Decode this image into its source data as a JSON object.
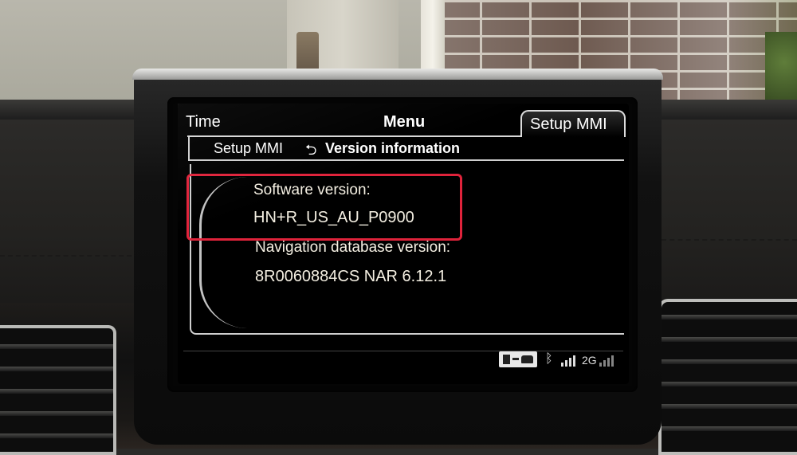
{
  "top_bar": {
    "left_tab": "Time",
    "center_tab": "Menu",
    "active_tab": "Setup MMI"
  },
  "breadcrumb": {
    "parent": "Setup MMI",
    "back_glyph": "⮌",
    "current": "Version information"
  },
  "content": {
    "software_label": "Software version:",
    "software_value": "HN+R_US_AU_P0900",
    "nav_label": "Navigation database version:",
    "nav_value": "8R0060884CS NAR 6.12.1"
  },
  "status_bar": {
    "icons": [
      "car-connection-icon",
      "bluetooth-icon",
      "signal-strength-icon",
      "network-signal-icon"
    ],
    "network": "2G"
  },
  "colors": {
    "highlight": "#e0233b",
    "text": "#f4efe2",
    "screen": "#000000"
  }
}
